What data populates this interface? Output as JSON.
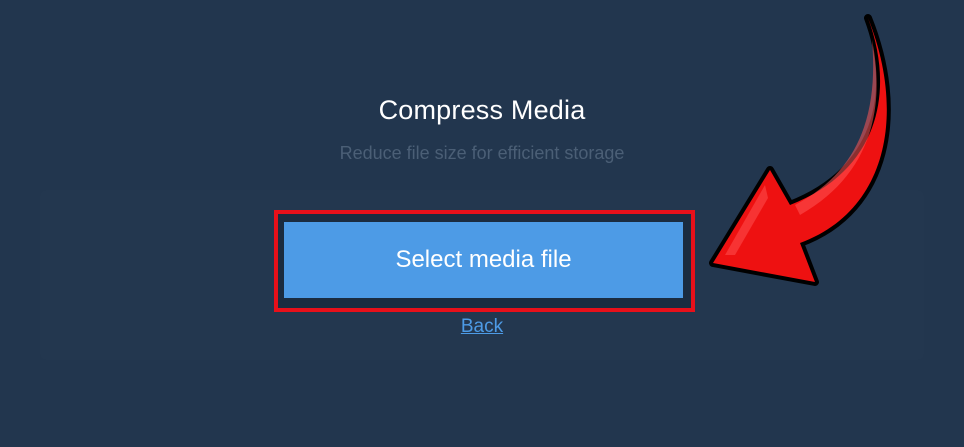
{
  "title": "Compress Media",
  "subtitle": "Reduce file size for efficient storage",
  "select_button": "Select media file",
  "back_link": "Back",
  "annotation": {
    "arrow_icon": "curved-arrow-icon",
    "highlight_color": "#e8101a"
  },
  "colors": {
    "background": "#22364e",
    "button": "#4d9be6",
    "link": "#4d9be6"
  }
}
